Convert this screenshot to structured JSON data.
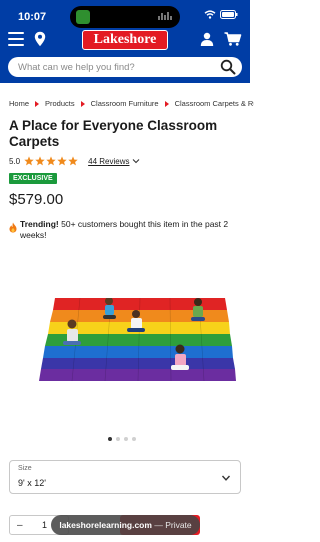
{
  "status_bar": {
    "time": "10:07"
  },
  "header": {
    "logo": "Lakeshore",
    "search_placeholder": "What can we help you find?"
  },
  "breadcrumb": [
    "Home",
    "Products",
    "Classroom Furniture",
    "Classroom Carpets & Rugs"
  ],
  "product": {
    "title": "A Place for Everyone Classroom Carpets",
    "rating": "5.0",
    "stars": 5,
    "reviews": "44 Reviews",
    "badge": "EXCLUSIVE",
    "price": "$579.00",
    "trending_label": "Trending!",
    "trending_text": "50+ customers bought this item in the past 2 weeks!"
  },
  "gallery": {
    "dots": 4,
    "active": 0
  },
  "size": {
    "label": "Size",
    "value": "9' x 12'"
  },
  "quantity": {
    "value": "1",
    "minus": "–"
  },
  "browser": {
    "domain": "lakeshorelearning.com",
    "separator": "—",
    "mode": "Private"
  },
  "colors": {
    "header_blue": "#003da5",
    "logo_red": "#e31b23",
    "star_orange": "#f08a1c",
    "badge_green": "#1b9a3c"
  },
  "icons": [
    "menu-icon",
    "location-pin-icon",
    "user-icon",
    "cart-icon",
    "search-icon",
    "star-icon",
    "chevron-down-icon",
    "flame-icon"
  ]
}
